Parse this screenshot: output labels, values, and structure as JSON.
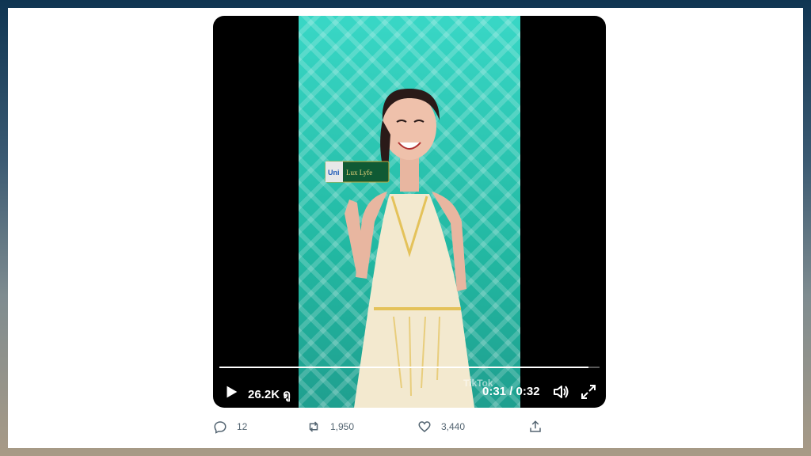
{
  "video": {
    "views": "26.2K ดู",
    "current_time": "0:31",
    "duration": "0:32",
    "time_display": "0:31 / 0:32",
    "progress_fraction": 0.97,
    "watermark": "TikTok"
  },
  "product": {
    "label_left": "Uni",
    "label_main": "Lux Lyfe"
  },
  "actions": {
    "replies": "12",
    "reposts": "1,950",
    "likes": "3,440"
  },
  "colors": {
    "stage_teal": "#22b8a2",
    "metric_gray": "#536471"
  },
  "icons": [
    "play-icon",
    "volume-icon",
    "fullscreen-icon",
    "reply-icon",
    "repost-icon",
    "like-icon",
    "share-icon"
  ]
}
